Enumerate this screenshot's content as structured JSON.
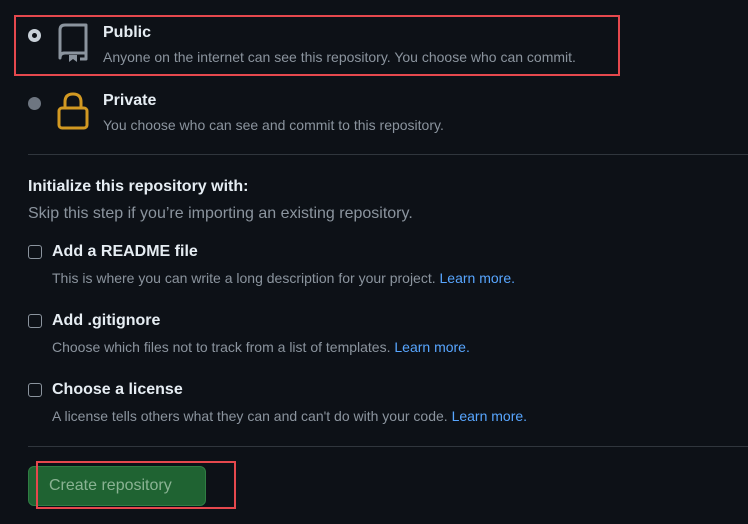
{
  "visibility": {
    "options": [
      {
        "title": "Public",
        "description": "Anyone on the internet can see this repository. You choose who can commit.",
        "selected": true,
        "icon": "repo-book-icon"
      },
      {
        "title": "Private",
        "description": "You choose who can see and commit to this repository.",
        "selected": false,
        "icon": "lock-icon",
        "icon_color": "#d29922"
      }
    ]
  },
  "initialize": {
    "heading": "Initialize this repository with:",
    "subheading": "Skip this step if you’re importing an existing repository.",
    "options": [
      {
        "title": "Add a README file",
        "description": "This is where you can write a long description for your project.",
        "link": "Learn more.",
        "checked": false
      },
      {
        "title": "Add .gitignore",
        "description": "Choose which files not to track from a list of templates.",
        "link": "Learn more.",
        "checked": false
      },
      {
        "title": "Choose a license",
        "description": "A license tells others what they can and can't do with your code.",
        "link": "Learn more.",
        "checked": false
      }
    ]
  },
  "create_button": {
    "label": "Create repository",
    "background": "#1f6332"
  },
  "colors": {
    "background": "#0d1117",
    "text_primary": "#e6edf3",
    "text_muted": "#8b949e",
    "link": "#58a6ff",
    "highlight": "#e5484d"
  }
}
